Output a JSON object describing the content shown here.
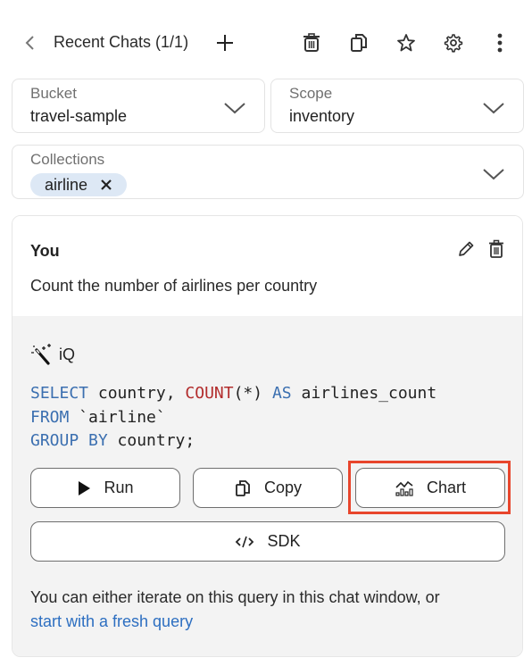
{
  "header": {
    "title": "Recent Chats (1/1)",
    "icons": [
      "back-icon",
      "plus-icon",
      "trash-icon",
      "copy-icon",
      "star-icon",
      "gear-icon",
      "more-vertical-icon"
    ]
  },
  "filters": {
    "bucket": {
      "label": "Bucket",
      "value": "travel-sample"
    },
    "scope": {
      "label": "Scope",
      "value": "inventory"
    },
    "collections": {
      "label": "Collections",
      "chips": [
        "airline"
      ]
    }
  },
  "chat": {
    "user": {
      "label": "You",
      "message": "Count the number of airlines per country"
    },
    "assistant": {
      "label": "iQ",
      "query_lines": [
        [
          {
            "t": "SELECT",
            "c": "kw"
          },
          {
            "t": " country, "
          },
          {
            "t": "COUNT",
            "c": "fn"
          },
          {
            "t": "(*) "
          },
          {
            "t": "AS",
            "c": "kw"
          },
          {
            "t": " airlines_count"
          }
        ],
        [
          {
            "t": "FROM",
            "c": "kw"
          },
          {
            "t": " `airline`"
          }
        ],
        [
          {
            "t": "GROUP BY",
            "c": "kw"
          },
          {
            "t": " country;"
          }
        ]
      ],
      "buttons": {
        "run": "Run",
        "copy": "Copy",
        "chart": "Chart",
        "sdk": "SDK"
      },
      "hint_text": "You can either iterate on this query in this chat window, or",
      "hint_link": "start with a fresh query"
    }
  },
  "colors": {
    "keyword": "#3b6fb0",
    "function": "#b22c2c",
    "link": "#2d6fc1",
    "chip_bg": "#dde8f5",
    "highlight": "#e8452c"
  }
}
